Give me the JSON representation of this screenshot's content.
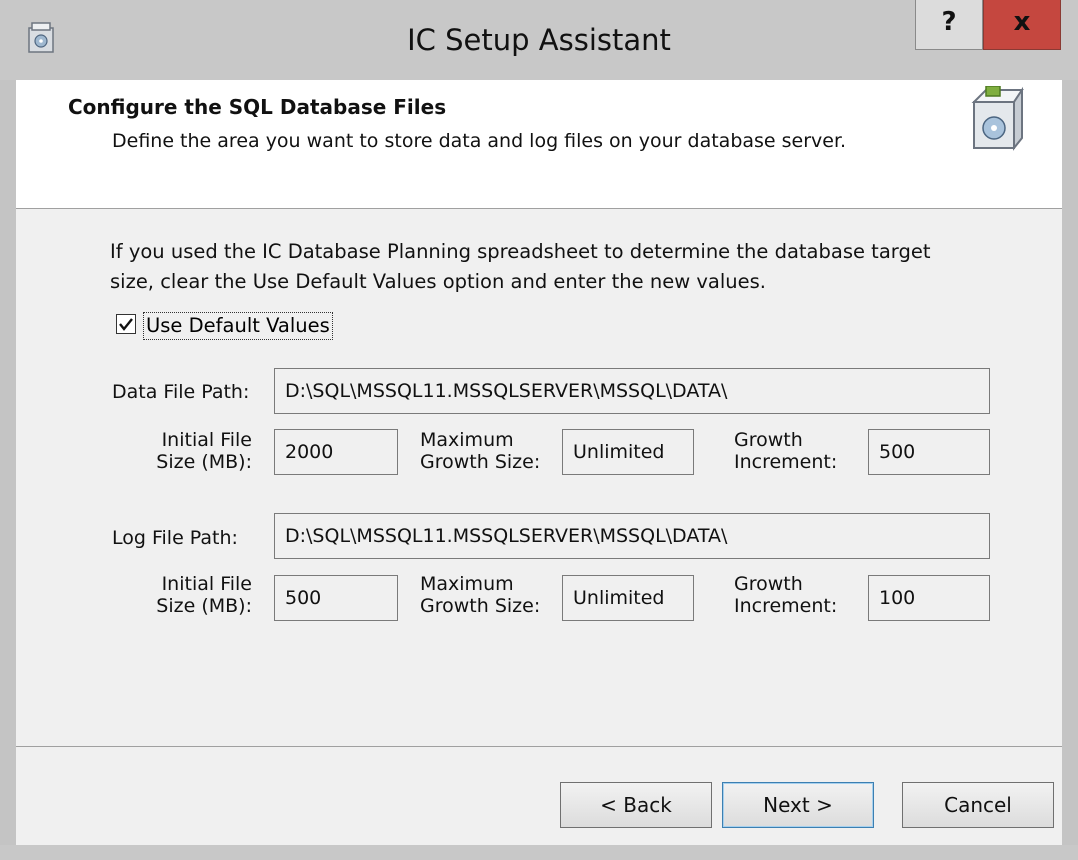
{
  "window": {
    "title": "IC Setup Assistant",
    "help_label": "?",
    "close_label": "x"
  },
  "header": {
    "title": "Configure the SQL Database Files",
    "subtitle": "Define the area you want to store data and log files on your database server."
  },
  "intro": {
    "line1": "If you used the IC Database Planning spreadsheet to determine the database target",
    "line2": "size, clear the Use Default Values option and enter the new values."
  },
  "use_defaults": {
    "label": "Use Default Values",
    "checked": true
  },
  "data_file": {
    "path_label": "Data File Path:",
    "path": "D:\\SQL\\MSSQL11.MSSQLSERVER\\MSSQL\\DATA\\",
    "initial_label_1": "Initial File",
    "initial_label_2": "Size (MB):",
    "initial": "2000",
    "max_label_1": "Maximum",
    "max_label_2": "Growth Size:",
    "max": "Unlimited",
    "growth_label_1": "Growth",
    "growth_label_2": "Increment:",
    "growth": "500"
  },
  "log_file": {
    "path_label": "Log File Path:",
    "path": "D:\\SQL\\MSSQL11.MSSQLSERVER\\MSSQL\\DATA\\",
    "initial_label_1": "Initial File",
    "initial_label_2": "Size (MB):",
    "initial": "500",
    "max_label_1": "Maximum",
    "max_label_2": "Growth Size:",
    "max": "Unlimited",
    "growth_label_1": "Growth",
    "growth_label_2": "Increment:",
    "growth": "100"
  },
  "buttons": {
    "back": "< Back",
    "next": "Next >",
    "cancel": "Cancel"
  }
}
